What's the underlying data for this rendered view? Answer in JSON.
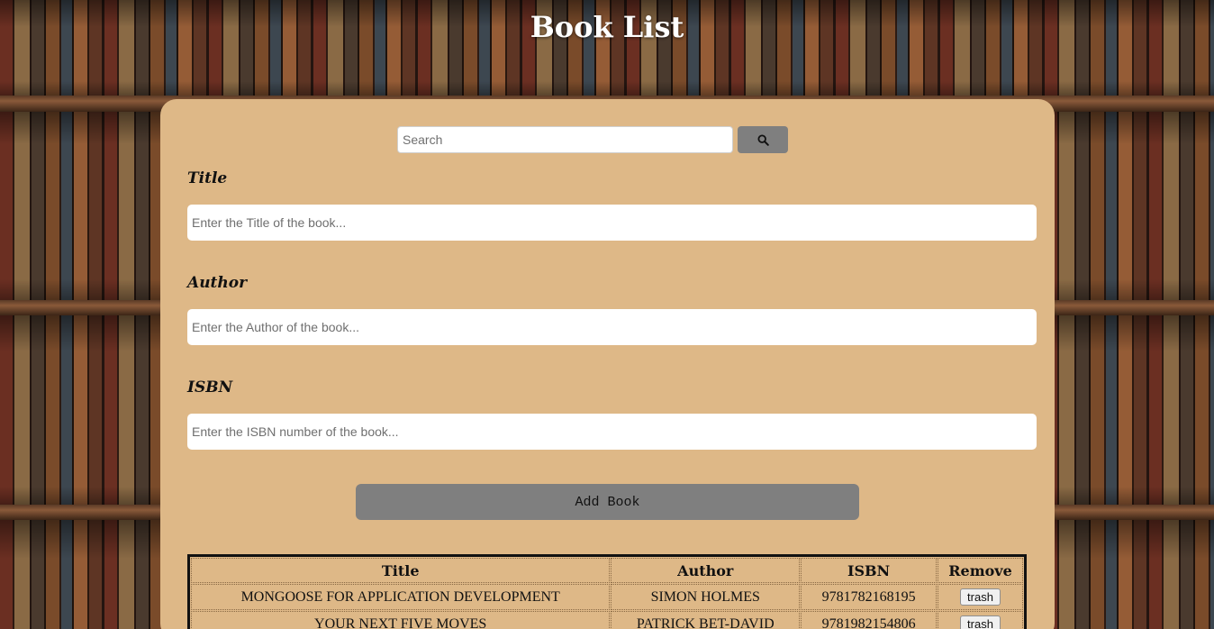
{
  "header": {
    "title": "Book List"
  },
  "search": {
    "placeholder": "Search",
    "value": "",
    "button_icon": "search-icon"
  },
  "form": {
    "title_label": "Title",
    "title_placeholder": "Enter the Title of the book...",
    "author_label": "Author",
    "author_placeholder": "Enter the Author of the book...",
    "isbn_label": "ISBN",
    "isbn_placeholder": "Enter the ISBN number of the book...",
    "add_button_label": "Add Book"
  },
  "table": {
    "columns": [
      "Title",
      "Author",
      "ISBN",
      "Remove"
    ],
    "rows": [
      {
        "title": "MONGOOSE FOR APPLICATION DEVELOPMENT",
        "author": "SIMON HOLMES",
        "isbn": "9781782168195",
        "remove_label": "trash"
      },
      {
        "title": "YOUR NEXT FIVE MOVES",
        "author": "PATRICK BET-DAVID",
        "isbn": "9781982154806",
        "remove_label": "trash"
      }
    ]
  },
  "colors": {
    "panel_background": "#deb887",
    "button_gray": "#7f7f7f",
    "title_text": "#ffffff"
  }
}
